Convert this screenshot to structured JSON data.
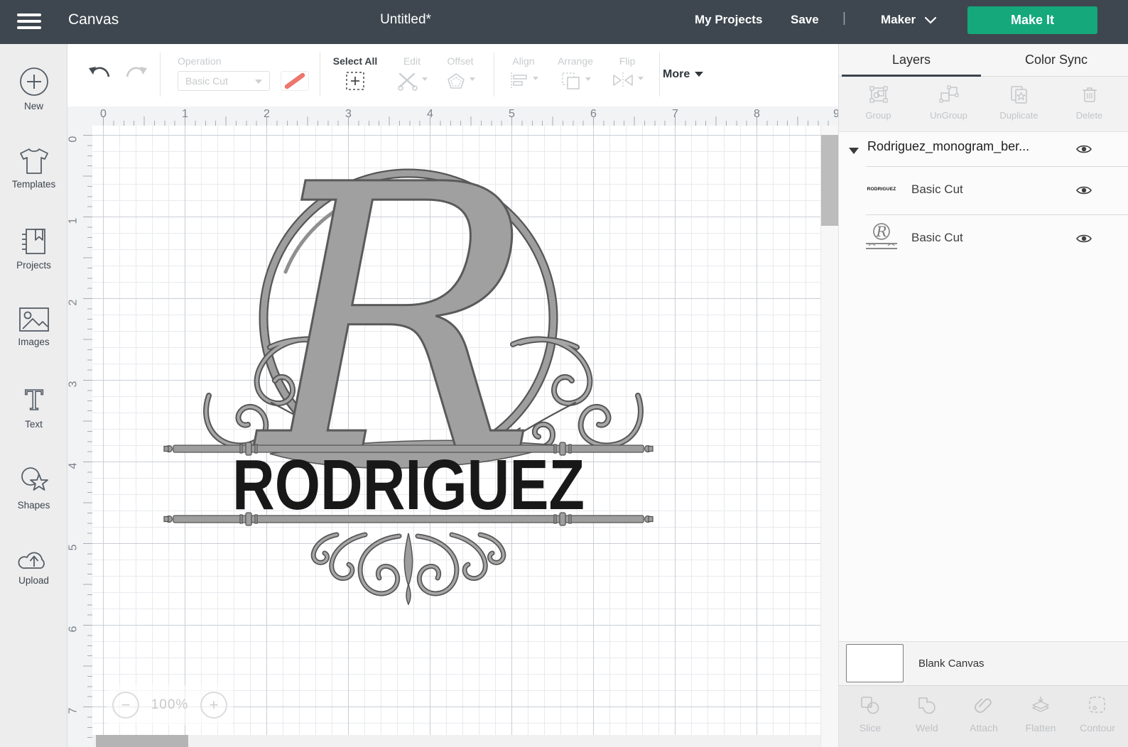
{
  "topbar": {
    "menu_label": "Canvas",
    "title": "Untitled*",
    "my_projects": "My Projects",
    "save": "Save",
    "separator": "|",
    "machine": "Maker",
    "make_it": "Make It"
  },
  "sidebar": {
    "items": [
      {
        "label": "New",
        "icon": "plus-circle-icon"
      },
      {
        "label": "Templates",
        "icon": "tshirt-icon"
      },
      {
        "label": "Projects",
        "icon": "notebook-icon"
      },
      {
        "label": "Images",
        "icon": "picture-icon"
      },
      {
        "label": "Text",
        "icon": "letter-t-icon"
      },
      {
        "label": "Shapes",
        "icon": "circle-star-icon"
      },
      {
        "label": "Upload",
        "icon": "cloud-upload-icon"
      }
    ]
  },
  "toolbar": {
    "operation_label": "Operation",
    "operation_value": "Basic Cut",
    "select_all": "Select All",
    "edit": "Edit",
    "offset": "Offset",
    "align": "Align",
    "arrange": "Arrange",
    "flip": "Flip",
    "more": "More"
  },
  "rulers": {
    "horizontal": [
      "0",
      "1",
      "2",
      "3",
      "4",
      "5",
      "6",
      "7",
      "8",
      "9"
    ],
    "vertical": [
      "0",
      "1",
      "2",
      "3",
      "4",
      "5",
      "6",
      "7"
    ]
  },
  "canvas": {
    "zoom": {
      "out": "−",
      "level": "100%",
      "in": "+"
    },
    "design": {
      "monogram_letter": "R",
      "name_text": "RODRIGUEZ"
    }
  },
  "layers_panel": {
    "tabs": {
      "layers": "Layers",
      "color_sync": "Color Sync"
    },
    "actions": {
      "group": "Group",
      "ungroup": "UnGroup",
      "duplicate": "Duplicate",
      "delete": "Delete"
    },
    "group_title": "Rodriguez_monogram_ber...",
    "rows": [
      {
        "thumb_text": "RODRIGUEZ",
        "label": "Basic Cut"
      },
      {
        "label": "Basic Cut"
      }
    ],
    "blank_canvas": "Blank Canvas",
    "bottom_actions": {
      "slice": "Slice",
      "weld": "Weld",
      "attach": "Attach",
      "flatten": "Flatten",
      "contour": "Contour"
    }
  },
  "colors": {
    "topbar_bg": "#3e474f",
    "accent_green": "#14a87b",
    "design_gray": "#9e9e9e",
    "design_outline": "#565656",
    "name_black": "#181818",
    "swatch_red": "#ed766d"
  }
}
